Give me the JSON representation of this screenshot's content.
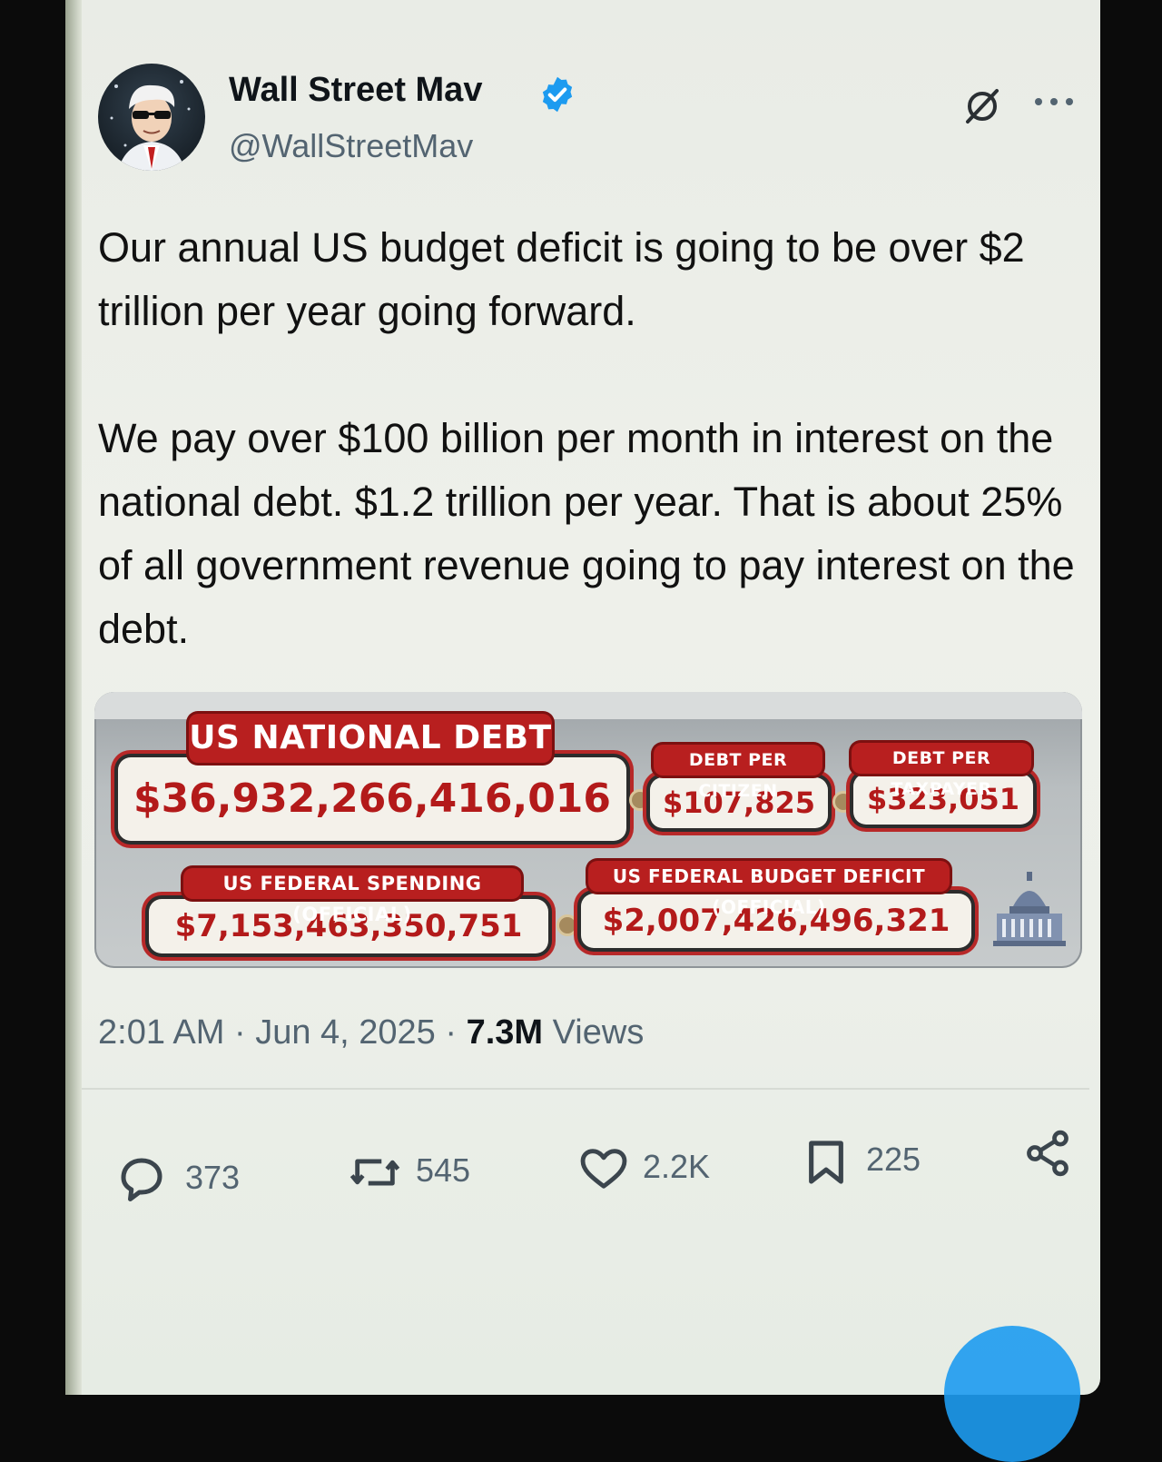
{
  "author": {
    "display_name": "Wall Street Mav",
    "handle": "@WallStreetMav",
    "verified": true,
    "accent_color": "#1d9bf0"
  },
  "tweet": {
    "text": "Our annual US budget deficit is going to be over $2 trillion per year going forward.\n\nWe pay over $100 billion per month in interest on the national debt. $1.2 trillion per year. That is about 25% of all government revenue going to pay interest on the debt."
  },
  "debt_clock": {
    "national_debt_label": "US NATIONAL DEBT",
    "national_debt_value": "$36,932,266,416,016",
    "per_citizen_label": "DEBT PER CITIZEN",
    "per_citizen_value": "$107,825",
    "per_taxpayer_label": "DEBT PER TAXPAYER",
    "per_taxpayer_value": "$323,051",
    "spending_label": "US FEDERAL SPENDING (OFFICIAL)",
    "spending_value": "$7,153,463,350,751",
    "deficit_label": "US FEDERAL BUDGET DEFICIT (OFFICIAL)",
    "deficit_value": "$2,007,426,496,321",
    "colors": {
      "label_red": "#b81f1f",
      "value_red": "#b31a1a"
    }
  },
  "meta": {
    "time": "2:01 AM",
    "separator": "·",
    "date": "Jun 4, 2025",
    "views_count": "7.3M",
    "views_label": "Views"
  },
  "actions": {
    "replies": "373",
    "reposts": "545",
    "likes": "2.2K",
    "bookmarks": "225"
  },
  "icons": [
    "grok-icon",
    "more-icon",
    "reply-icon",
    "repost-icon",
    "like-icon",
    "bookmark-icon",
    "share-icon",
    "verified-badge-icon",
    "capitol-icon"
  ]
}
